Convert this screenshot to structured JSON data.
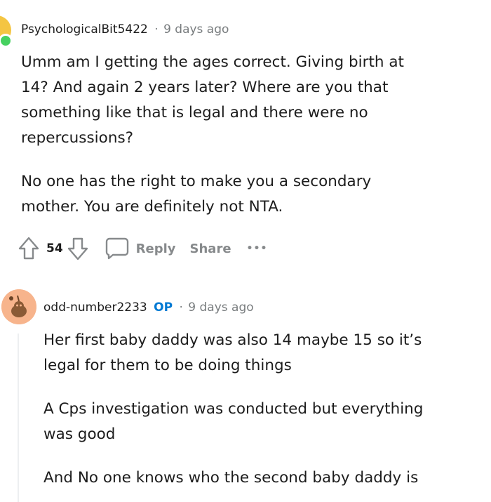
{
  "comments": [
    {
      "username": "PsychologicalBit5422",
      "separator": "·",
      "time": "9 days ago",
      "paragraphs": [
        [
          "Umm am I getting the ages correct. Giving birth at",
          "14? And again 2 years later? Where are you that",
          "something like that is legal and there were no",
          "repercussions?"
        ],
        [
          "No one has the right to make you a secondary",
          "mother. You are definitely not NTA."
        ]
      ],
      "actions": {
        "vote_count": "54",
        "reply_label": "Reply",
        "share_label": "Share",
        "more_label": "•••"
      }
    },
    {
      "username": "odd-number2233",
      "op_badge": "OP",
      "separator": "·",
      "time": "9 days ago",
      "paragraphs": [
        [
          "Her first baby daddy was also 14 maybe 15 so it’s",
          "legal for them to be doing things"
        ],
        [
          "A Cps investigation was conducted but everything",
          "was good"
        ],
        [
          "And No one knows who the second baby daddy is"
        ]
      ]
    }
  ],
  "colors": {
    "online": "#46d160",
    "op_badge": "#0079d3",
    "meta_grey": "#787c7e",
    "action_grey": "#878a8c"
  },
  "icons": [
    "online-status-icon",
    "upvote-icon",
    "downvote-icon",
    "comment-icon",
    "more-icon",
    "snoo-avatar-icon"
  ]
}
